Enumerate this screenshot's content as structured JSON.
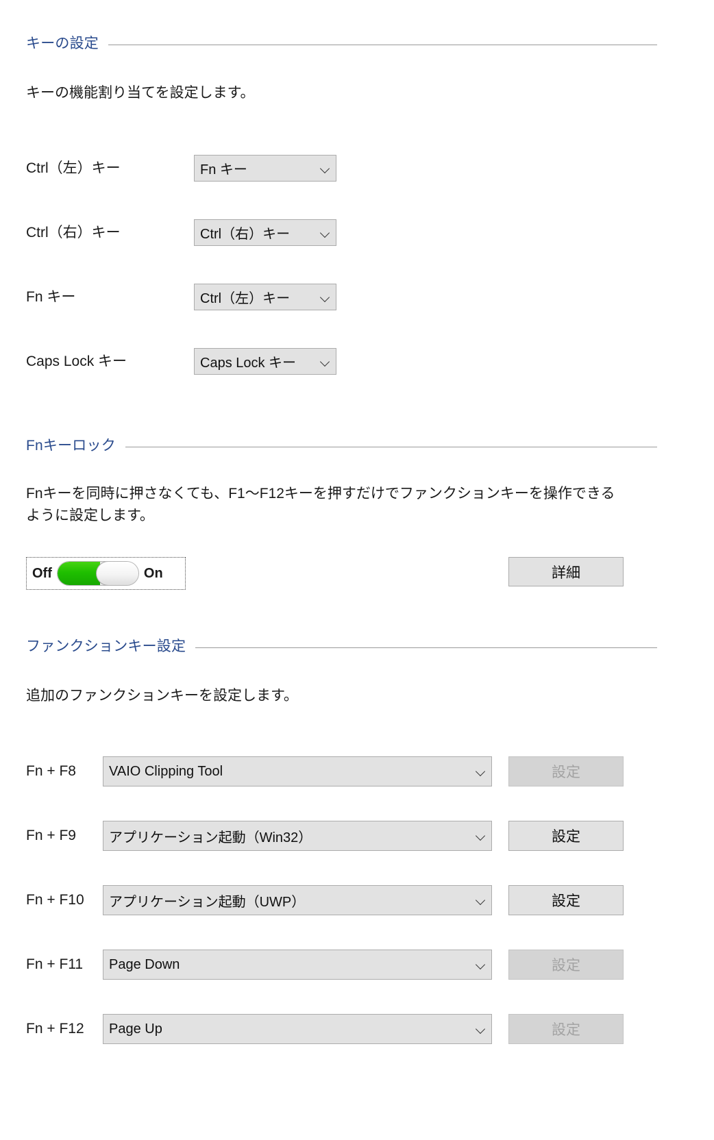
{
  "sections": {
    "key_settings": {
      "title": "キーの設定",
      "description": "キーの機能割り当てを設定します。",
      "rows": [
        {
          "label": "Ctrl（左）キー",
          "value": "Fn キー"
        },
        {
          "label": "Ctrl（右）キー",
          "value": "Ctrl（右）キー"
        },
        {
          "label": "Fn キー",
          "value": "Ctrl（左）キー"
        },
        {
          "label": "Caps Lock キー",
          "value": "Caps Lock キー"
        }
      ]
    },
    "fn_key_lock": {
      "title": "Fnキーロック",
      "description": "Fnキーを同時に押さなくても、F1〜F12キーを押すだけでファンクションキーを操作できるように設定します。",
      "toggle": {
        "off_label": "Off",
        "on_label": "On",
        "state": "On",
        "track_color": "#1fbf00"
      },
      "detail_button": "詳細"
    },
    "function_key_settings": {
      "title": "ファンクションキー設定",
      "description": "追加のファンクションキーを設定します。",
      "button_label": "設定",
      "rows": [
        {
          "label": "Fn + F8",
          "value": "VAIO Clipping Tool",
          "button": "設定",
          "button_enabled": false
        },
        {
          "label": "Fn + F9",
          "value": "アプリケーション起動（Win32）",
          "button": "設定",
          "button_enabled": true
        },
        {
          "label": "Fn + F10",
          "value": "アプリケーション起動（UWP）",
          "button": "設定",
          "button_enabled": true
        },
        {
          "label": "Fn + F11",
          "value": "Page Down",
          "button": "設定",
          "button_enabled": false
        },
        {
          "label": "Fn + F12",
          "value": "Page Up",
          "button": "設定",
          "button_enabled": false
        }
      ]
    }
  },
  "colors": {
    "section_title": "#2a4b8d",
    "rule": "#9a9a9a",
    "control_bg": "#e2e2e2",
    "control_border": "#acacac",
    "disabled_bg": "#d4d4d4",
    "disabled_text": "#a3a3a3",
    "toggle_green": "#1fbf00"
  },
  "icons": {
    "chevron": "chevron-down-icon"
  }
}
